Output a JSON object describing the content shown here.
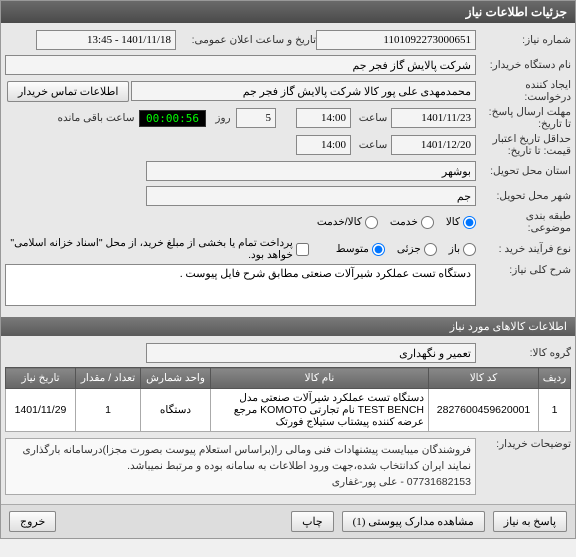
{
  "panel_title": "جزئیات اطلاعات نیاز",
  "form": {
    "need_no_label": "شماره نیاز:",
    "need_no": "1101092273000651",
    "announce_label": "تاریخ و ساعت اعلان عمومی:",
    "announce": "1401/11/18 - 13:45",
    "buyer_org_label": "نام دستگاه خریدار:",
    "buyer_org": "شرکت پالایش گاز فجر جم",
    "requester_label": "ایجاد کننده درخواست:",
    "requester": "محمدمهدی علی پور کالا شرکت پالایش گاز فجر جم",
    "contact_btn": "اطلاعات تماس خریدار",
    "deadline_label": "مهلت ارسال پاسخ: تا تاریخ:",
    "deadline_date": "1401/11/23",
    "time_label": "ساعت",
    "deadline_time": "14:00",
    "day_label": "روز",
    "days": "5",
    "remain_label": "ساعت باقی مانده",
    "remain": "00:00:56",
    "validity_label": "حداقل تاریخ اعتبار قیمت: تا تاریخ:",
    "validity_date": "1401/12/20",
    "validity_time": "14:00",
    "province_label": "استان محل تحویل:",
    "province": "بوشهر",
    "city_label": "شهر محل تحویل:",
    "city": "جم",
    "category_label": "طبقه بندی موضوعی:",
    "cat_goods": "کالا",
    "cat_service": "خدمت",
    "cat_mixed": "کالا/خدمت",
    "process_label": "نوع فرآیند خرید :",
    "proc_open": "باز",
    "proc_partial": "جزئی",
    "proc_limited": "متوسط",
    "payment_note": "پرداخت تمام یا بخشی از مبلغ خرید، از محل \"اسناد خزانه اسلامی\" خواهد بود.",
    "desc_label": "شرح کلی نیاز:",
    "desc": "دستگاه تست عملکرد شیرآلات صنعتی مطابق شرح فایل پیوست ."
  },
  "items_header": "اطلاعات کالاهای مورد نیاز",
  "group_label": "گروه کالا:",
  "group_value": "تعمیر و نگهداری",
  "table": {
    "headers": [
      "ردیف",
      "کد کالا",
      "نام کالا",
      "واحد شمارش",
      "تعداد / مقدار",
      "تاریخ نیاز"
    ],
    "rows": [
      {
        "idx": "1",
        "code": "2827600459620001",
        "name": "دستگاه تست عملکرد شیرآلات صنعتی مدل TEST BENCH نام تجارتی KOMOTO مرجع عرضه کننده پیشتاب ستیلاج فورتک",
        "unit": "دستگاه",
        "qty": "1",
        "date": "1401/11/29"
      }
    ]
  },
  "seller_note_label": "توضیحات خریدار:",
  "seller_note": "فروشندگان میبایست پیشنهادات فنی ومالی را(براساس استعلام پیوست بصورت مجزا)درسامانه بارگذاری نمایند ایران کدانتخاب شده،جهت ورود اطلاعات به سامانه بوده و مرتبط نمیباشد.\n07731682153 - علی پور-غفاری",
  "buttons": {
    "reply": "پاسخ به نیاز",
    "attachments": "مشاهده مدارک پیوستی (1)",
    "print": "چاپ",
    "close": "خروج"
  }
}
